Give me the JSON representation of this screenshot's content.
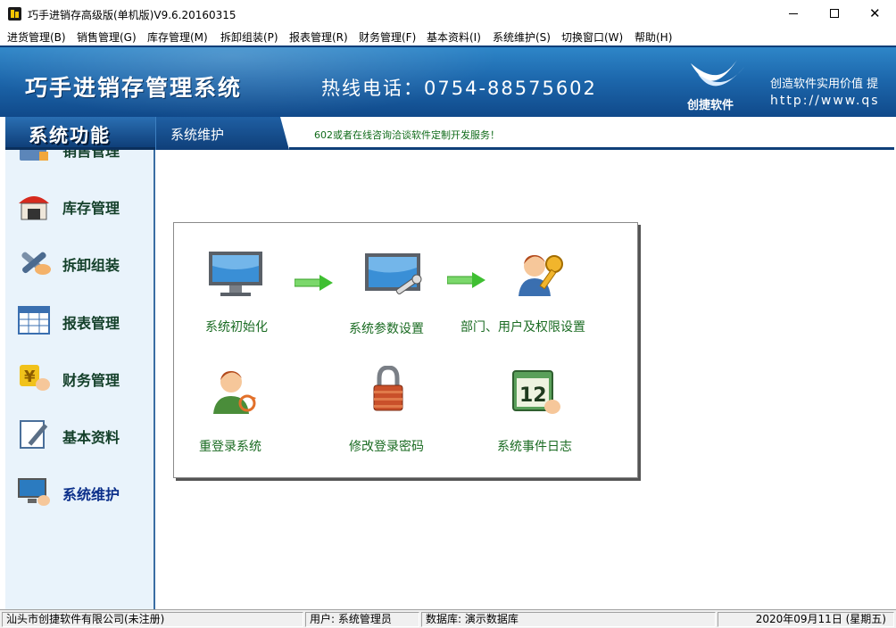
{
  "window": {
    "title": "巧手进销存高级版(单机版)V9.6.20160315",
    "minimize_label": "—",
    "close_label": "✕"
  },
  "menu": [
    "进货管理(B)",
    "销售管理(G)",
    "库存管理(M)",
    "拆卸组装(P)",
    "报表管理(R)",
    "财务管理(F)",
    "基本资料(I)",
    "系统维护(S)",
    "切换窗口(W)",
    "帮助(H)"
  ],
  "banner": {
    "title": "巧手进销存管理系统",
    "hotline": "热线电话：0754-88575602",
    "brand": "创捷软件",
    "slogan": "创造软件实用价值  提",
    "url": "http://www.qs"
  },
  "section": {
    "left_title": "系统功能",
    "current": "系统维护",
    "marquee": "602或者在线咨询洽谈软件定制开发服务！"
  },
  "sidebar": {
    "items": [
      {
        "label": "销售管理",
        "icon": "cash-register-icon"
      },
      {
        "label": "库存管理",
        "icon": "warehouse-icon"
      },
      {
        "label": "拆卸组装",
        "icon": "tools-icon"
      },
      {
        "label": "报表管理",
        "icon": "spreadsheet-icon"
      },
      {
        "label": "财务管理",
        "icon": "yen-hand-icon"
      },
      {
        "label": "基本资料",
        "icon": "pencil-document-icon"
      },
      {
        "label": "系统维护",
        "icon": "monitor-hand-icon"
      }
    ]
  },
  "tiles": [
    {
      "label": "系统初始化",
      "icon": "monitor-icon"
    },
    {
      "label": "系统参数设置",
      "icon": "monitor-wrench-icon"
    },
    {
      "label": "部门、用户及权限设置",
      "icon": "user-key-icon"
    },
    {
      "label": "重登录系统",
      "icon": "user-refresh-icon"
    },
    {
      "label": "修改登录密码",
      "icon": "padlock-icon"
    },
    {
      "label": "系统事件日志",
      "icon": "calendar-icon"
    }
  ],
  "calendar_day": "12",
  "status": {
    "company": "汕头市创捷软件有限公司(未注册)",
    "user": "用户: 系统管理员",
    "database": "数据库: 演示数据库",
    "date": "2020年09月11日  (星期五)"
  },
  "colors": {
    "banner_blue": "#1d68ad",
    "sidebar_bg": "#e9f3fb",
    "tile_label_green": "#1a6b22",
    "marquee_green": "#106b1a"
  }
}
